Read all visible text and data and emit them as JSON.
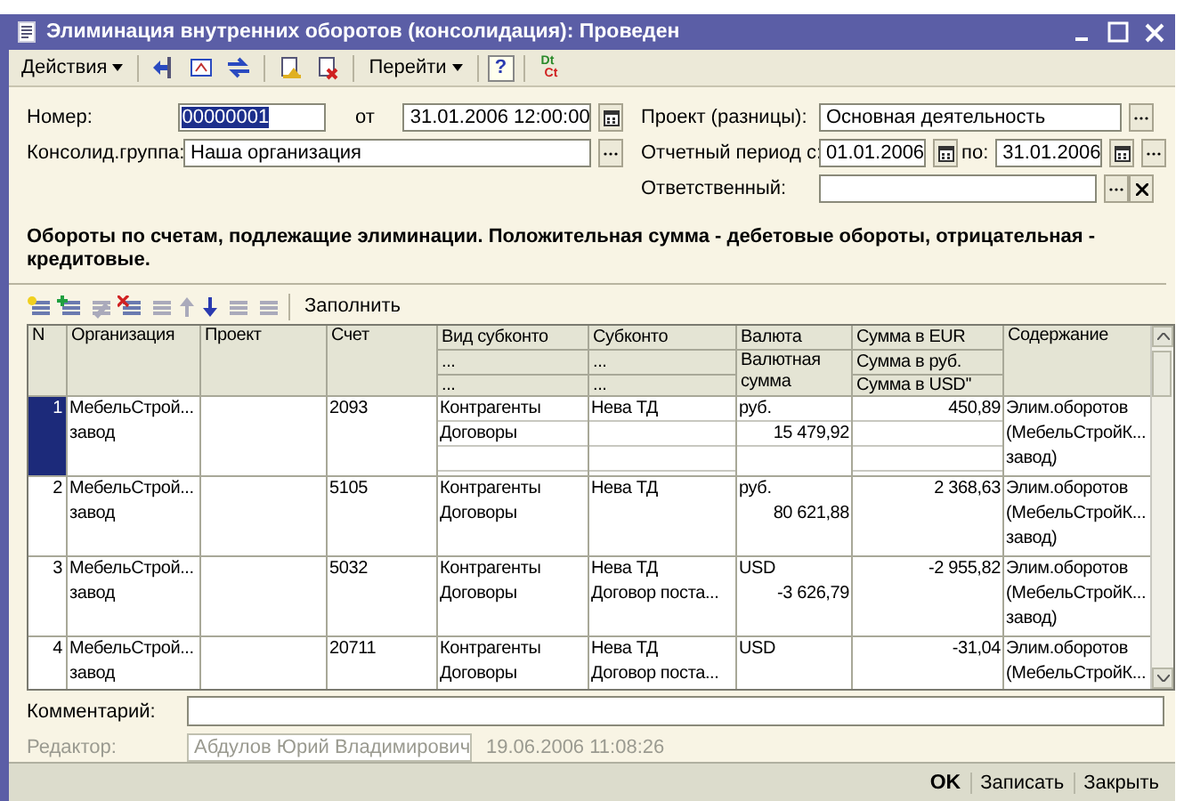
{
  "window": {
    "title": "Элиминация внутренних оборотов (консолидация): Проведен"
  },
  "toolbar": {
    "menus": [
      "Действия",
      "Перейти"
    ],
    "help": "?",
    "dt": "Dt",
    "ct": "Ct"
  },
  "form": {
    "number_label": "Номер:",
    "number": "00000001",
    "date_label": "от",
    "date": "31.01.2006 12:00:00",
    "group_label": "Консолид.группа:",
    "group": "Наша организация",
    "project_label": "Проект (разницы):",
    "project": "Основная деятельность",
    "period_label": "Отчетный период с:",
    "period_from": "01.01.2006",
    "period_to_label": "по:",
    "period_to": "31.01.2006",
    "responsible_label": "Ответственный:"
  },
  "note": "Обороты по счетам, подлежащие элиминации. Положительная сумма - дебетовые обороты, отрицательная - кредитовые.",
  "table_toolbar": {
    "fill_button": "Заполнить"
  },
  "table": {
    "columns": [
      {
        "lines": [
          "N"
        ]
      },
      {
        "lines": [
          "Организация"
        ]
      },
      {
        "lines": [
          "Проект"
        ]
      },
      {
        "lines": [
          "Счет"
        ]
      },
      {
        "lines": [
          "Вид субконто",
          "...",
          "..."
        ]
      },
      {
        "lines": [
          "Субконто",
          "...",
          "..."
        ]
      },
      {
        "lines": [
          "Валюта",
          "Валютная сумма"
        ]
      },
      {
        "lines": [
          "Сумма в EUR",
          "Сумма в руб.",
          "Сумма в USD''"
        ]
      },
      {
        "lines": [
          "Содержание"
        ]
      }
    ],
    "rows": [
      {
        "selected": true,
        "n": "1",
        "org": [
          "МебельСтрой...",
          "завод"
        ],
        "account": "2093",
        "vid": [
          "Контрагенты",
          "Договоры"
        ],
        "subkonto": [
          "Нева ТД"
        ],
        "currency": "руб.",
        "amount": "15 479,92",
        "sum": "450,89",
        "content": [
          "Элим.оборотов",
          "(МебельСтройК...",
          "завод)"
        ]
      },
      {
        "selected": false,
        "n": "2",
        "org": [
          "МебельСтрой...",
          "завод"
        ],
        "account": "5105",
        "vid": [
          "Контрагенты",
          "Договоры"
        ],
        "subkonto": [
          "Нева ТД"
        ],
        "currency": "руб.",
        "amount": "80 621,88",
        "sum": "2 368,63",
        "content": [
          "Элим.оборотов",
          "(МебельСтройК...",
          "завод)"
        ]
      },
      {
        "selected": false,
        "n": "3",
        "org": [
          "МебельСтрой...",
          "завод"
        ],
        "account": "5032",
        "vid": [
          "Контрагенты",
          "Договоры"
        ],
        "subkonto": [
          "Нева ТД",
          "Договор поста..."
        ],
        "currency": "USD",
        "amount": "-3 626,79",
        "sum": "-2 955,82",
        "content": [
          "Элим.оборотов",
          "(МебельСтройК...",
          "завод)"
        ]
      },
      {
        "selected": false,
        "n": "4",
        "org": [
          "МебельСтрой...",
          "завод"
        ],
        "account": "20711",
        "vid": [
          "Контрагенты",
          "Договоры"
        ],
        "subkonto": [
          "Нева ТД",
          "Договор поста..."
        ],
        "currency": "USD",
        "sum": "-31,04",
        "content": [
          "Элим.оборотов",
          "(МебельСтройК..."
        ]
      }
    ]
  },
  "comment_label": "Комментарий:",
  "editor": {
    "label": "Редактор:",
    "value": "Абдулов Юрий Владимирович",
    "date": "19.06.2006 11:08:26"
  },
  "buttons": [
    {
      "label": "OK",
      "kind": "default"
    },
    {
      "label": "Записать",
      "kind": "normal"
    },
    {
      "label": "Закрыть",
      "kind": "normal"
    }
  ]
}
